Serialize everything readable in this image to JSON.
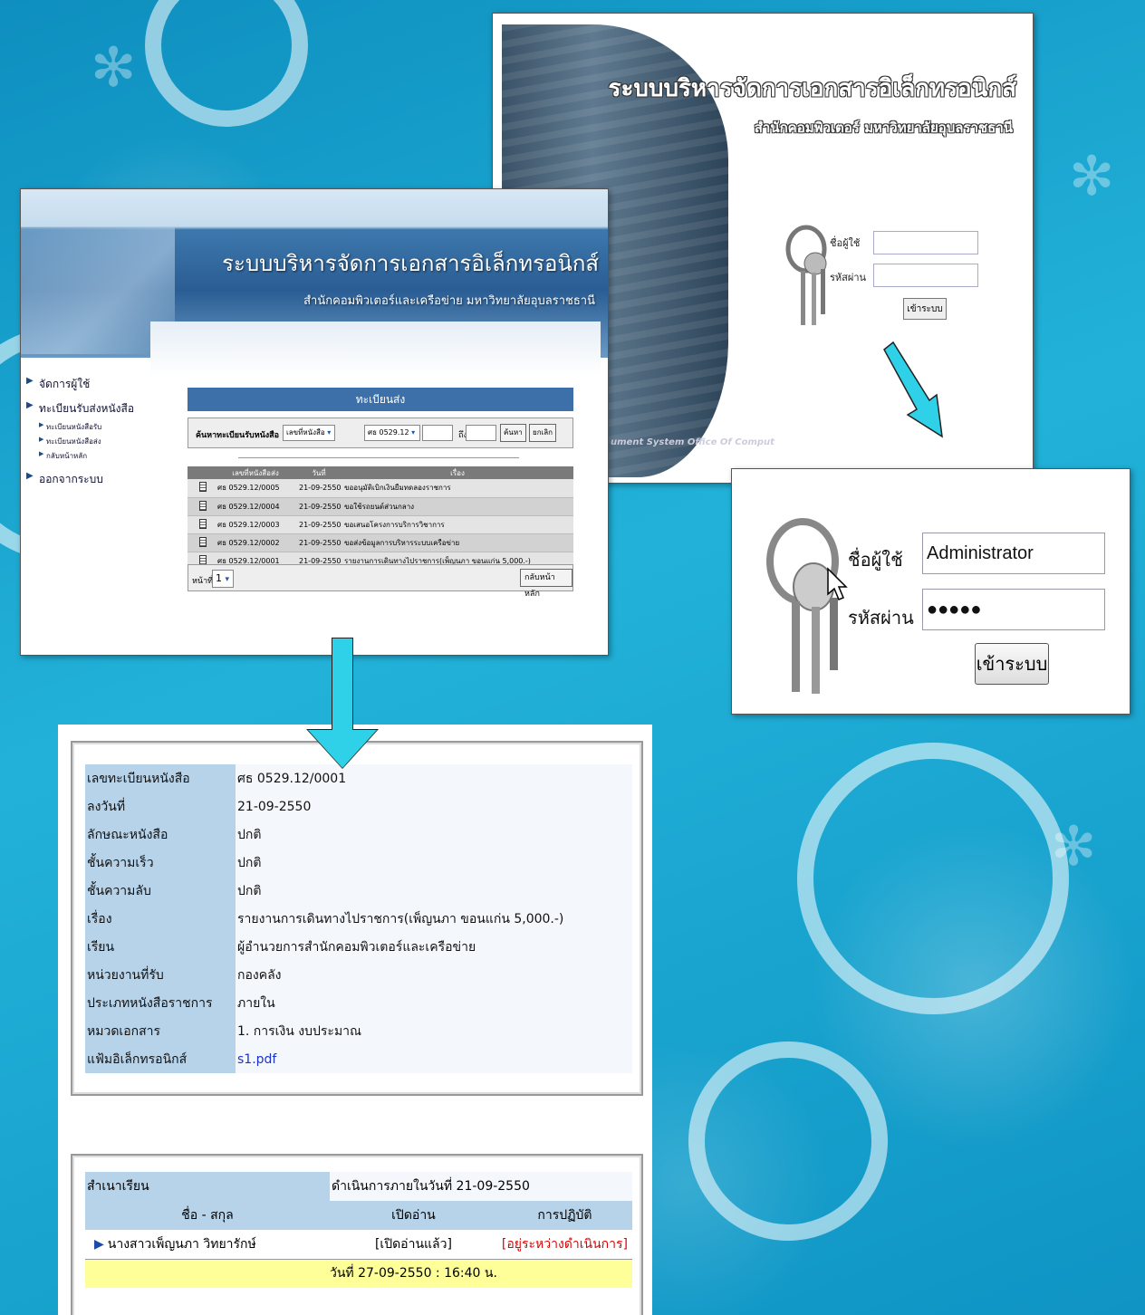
{
  "login": {
    "title": "ระบบบริหารจัดการเอกสารอิเล็กทรอนิกส์",
    "subtitle": "สำนักคอมพิวเตอร์ มหาวิทยาลัยอุบลราชธานี",
    "username_label": "ชื่อผู้ใช้",
    "password_label": "รหัสผ่าน",
    "login_button": "เข้าระบบ",
    "footer": "ument System   Office Of Comput"
  },
  "zoom_login": {
    "username_label": "ชื่อผู้ใช้",
    "password_label": "รหัสผ่าน",
    "username_value": "Administrator",
    "password_value": "●●●●●",
    "login_button": "เข้าระบบ"
  },
  "app": {
    "title": "ระบบบริหารจัดการเอกสารอิเล็กทรอนิกส์",
    "subtitle": "สำนักคอมพิวเตอร์และเครือข่าย มหาวิทยาลัยอุบลราชธานี",
    "sidebar": {
      "manage_users": "จัดการผู้ใช้",
      "registry": "ทะเบียนรับส่งหนังสือ",
      "sub_receive": "ทะเบียนหนังสือรับ",
      "sub_send": "ทะเบียนหนังสือส่ง",
      "sub_home": "กลับหน้าหลัก",
      "logout": "ออกจากระบบ"
    },
    "register_title": "ทะเบียนส่ง",
    "search": {
      "label": "ค้นหาทะเบียนรับหนังสือ",
      "field_select": "เลขที่หนังสือ",
      "prefix_select": "ศธ 0529.12",
      "to_label": "ถึง",
      "search_button": "ค้นหา",
      "cancel_button": "ยกเลิก"
    },
    "table": {
      "headers": [
        "",
        "เลขที่หนังสือส่ง",
        "วันที่",
        "เรื่อง"
      ],
      "rows": [
        {
          "no": "ศธ 0529.12/0005",
          "date": "21-09-2550",
          "subject": "ขออนุมัติเบิกเงินยืมทดลองราชการ"
        },
        {
          "no": "ศธ 0529.12/0004",
          "date": "21-09-2550",
          "subject": "ขอใช้รถยนต์ส่วนกลาง"
        },
        {
          "no": "ศธ 0529.12/0003",
          "date": "21-09-2550",
          "subject": "ขอเสนอโครงการบริการวิชาการ"
        },
        {
          "no": "ศธ 0529.12/0002",
          "date": "21-09-2550",
          "subject": "ขอส่งข้อมูลการบริหารระบบเครือข่าย"
        },
        {
          "no": "ศธ 0529.12/0001",
          "date": "21-09-2550",
          "subject": "รายงานการเดินทางไปราชการ(เพ็ญนภา ขอนแก่น 5,000.-)"
        }
      ]
    },
    "pager": {
      "label": "หน้าที่",
      "page": "1",
      "home_button": "กลับหน้าหลัก"
    }
  },
  "detail": {
    "rows": [
      {
        "k": "เลขทะเบียนหนังสือ",
        "v": "ศธ 0529.12/0001"
      },
      {
        "k": "ลงวันที่",
        "v": "21-09-2550"
      },
      {
        "k": "ลักษณะหนังสือ",
        "v": "ปกติ"
      },
      {
        "k": "ชั้นความเร็ว",
        "v": "ปกติ"
      },
      {
        "k": "ชั้นความลับ",
        "v": "ปกติ"
      },
      {
        "k": "เรื่อง",
        "v": "รายงานการเดินทางไปราชการ(เพ็ญนภา ขอนแก่น 5,000.-)"
      },
      {
        "k": "เรียน",
        "v": "ผู้อำนวยการสำนักคอมพิวเตอร์และเครือข่าย"
      },
      {
        "k": "หน่วยงานที่รับ",
        "v": "กองคลัง"
      },
      {
        "k": "ประเภทหนังสือราชการ",
        "v": "ภายใน"
      },
      {
        "k": "หมวดเอกสาร",
        "v": "1. การเงิน งบประมาณ"
      },
      {
        "k": "แฟ้มอิเล็กทรอนิกส์",
        "v": "s1.pdf"
      }
    ]
  },
  "routing": {
    "k": "สำเนาเรียน",
    "v": "ดำเนินการภายในวันที่ 21-09-2550",
    "headers": [
      "ชื่อ - สกุล",
      "เปิดอ่าน",
      "การปฏิบัติ"
    ],
    "row": {
      "name": "นางสาวเพ็ญนภา วิทยารักษ์",
      "read": "[เปิดอ่านแล้ว]",
      "action": "[อยู่ระหว่างดำเนินการ]"
    },
    "timestamp": "วันที่ 27-09-2550 : 16:40 น."
  },
  "colors": {
    "accent": "#3d6fa8",
    "background": "#1aa3cc",
    "arrow": "#2fd1e8",
    "status_red": "#e00000"
  }
}
